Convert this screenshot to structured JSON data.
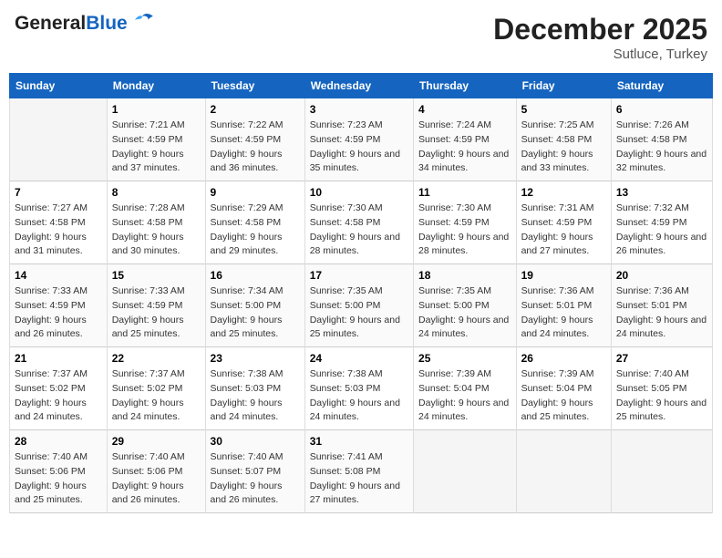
{
  "header": {
    "logo_general": "General",
    "logo_blue": "Blue",
    "month_title": "December 2025",
    "subtitle": "Sutluce, Turkey"
  },
  "days_of_week": [
    "Sunday",
    "Monday",
    "Tuesday",
    "Wednesday",
    "Thursday",
    "Friday",
    "Saturday"
  ],
  "weeks": [
    [
      {
        "day": "",
        "sunrise": "",
        "sunset": "",
        "daylight": ""
      },
      {
        "day": "1",
        "sunrise": "Sunrise: 7:21 AM",
        "sunset": "Sunset: 4:59 PM",
        "daylight": "Daylight: 9 hours and 37 minutes."
      },
      {
        "day": "2",
        "sunrise": "Sunrise: 7:22 AM",
        "sunset": "Sunset: 4:59 PM",
        "daylight": "Daylight: 9 hours and 36 minutes."
      },
      {
        "day": "3",
        "sunrise": "Sunrise: 7:23 AM",
        "sunset": "Sunset: 4:59 PM",
        "daylight": "Daylight: 9 hours and 35 minutes."
      },
      {
        "day": "4",
        "sunrise": "Sunrise: 7:24 AM",
        "sunset": "Sunset: 4:59 PM",
        "daylight": "Daylight: 9 hours and 34 minutes."
      },
      {
        "day": "5",
        "sunrise": "Sunrise: 7:25 AM",
        "sunset": "Sunset: 4:58 PM",
        "daylight": "Daylight: 9 hours and 33 minutes."
      },
      {
        "day": "6",
        "sunrise": "Sunrise: 7:26 AM",
        "sunset": "Sunset: 4:58 PM",
        "daylight": "Daylight: 9 hours and 32 minutes."
      }
    ],
    [
      {
        "day": "7",
        "sunrise": "Sunrise: 7:27 AM",
        "sunset": "Sunset: 4:58 PM",
        "daylight": "Daylight: 9 hours and 31 minutes."
      },
      {
        "day": "8",
        "sunrise": "Sunrise: 7:28 AM",
        "sunset": "Sunset: 4:58 PM",
        "daylight": "Daylight: 9 hours and 30 minutes."
      },
      {
        "day": "9",
        "sunrise": "Sunrise: 7:29 AM",
        "sunset": "Sunset: 4:58 PM",
        "daylight": "Daylight: 9 hours and 29 minutes."
      },
      {
        "day": "10",
        "sunrise": "Sunrise: 7:30 AM",
        "sunset": "Sunset: 4:58 PM",
        "daylight": "Daylight: 9 hours and 28 minutes."
      },
      {
        "day": "11",
        "sunrise": "Sunrise: 7:30 AM",
        "sunset": "Sunset: 4:59 PM",
        "daylight": "Daylight: 9 hours and 28 minutes."
      },
      {
        "day": "12",
        "sunrise": "Sunrise: 7:31 AM",
        "sunset": "Sunset: 4:59 PM",
        "daylight": "Daylight: 9 hours and 27 minutes."
      },
      {
        "day": "13",
        "sunrise": "Sunrise: 7:32 AM",
        "sunset": "Sunset: 4:59 PM",
        "daylight": "Daylight: 9 hours and 26 minutes."
      }
    ],
    [
      {
        "day": "14",
        "sunrise": "Sunrise: 7:33 AM",
        "sunset": "Sunset: 4:59 PM",
        "daylight": "Daylight: 9 hours and 26 minutes."
      },
      {
        "day": "15",
        "sunrise": "Sunrise: 7:33 AM",
        "sunset": "Sunset: 4:59 PM",
        "daylight": "Daylight: 9 hours and 25 minutes."
      },
      {
        "day": "16",
        "sunrise": "Sunrise: 7:34 AM",
        "sunset": "Sunset: 5:00 PM",
        "daylight": "Daylight: 9 hours and 25 minutes."
      },
      {
        "day": "17",
        "sunrise": "Sunrise: 7:35 AM",
        "sunset": "Sunset: 5:00 PM",
        "daylight": "Daylight: 9 hours and 25 minutes."
      },
      {
        "day": "18",
        "sunrise": "Sunrise: 7:35 AM",
        "sunset": "Sunset: 5:00 PM",
        "daylight": "Daylight: 9 hours and 24 minutes."
      },
      {
        "day": "19",
        "sunrise": "Sunrise: 7:36 AM",
        "sunset": "Sunset: 5:01 PM",
        "daylight": "Daylight: 9 hours and 24 minutes."
      },
      {
        "day": "20",
        "sunrise": "Sunrise: 7:36 AM",
        "sunset": "Sunset: 5:01 PM",
        "daylight": "Daylight: 9 hours and 24 minutes."
      }
    ],
    [
      {
        "day": "21",
        "sunrise": "Sunrise: 7:37 AM",
        "sunset": "Sunset: 5:02 PM",
        "daylight": "Daylight: 9 hours and 24 minutes."
      },
      {
        "day": "22",
        "sunrise": "Sunrise: 7:37 AM",
        "sunset": "Sunset: 5:02 PM",
        "daylight": "Daylight: 9 hours and 24 minutes."
      },
      {
        "day": "23",
        "sunrise": "Sunrise: 7:38 AM",
        "sunset": "Sunset: 5:03 PM",
        "daylight": "Daylight: 9 hours and 24 minutes."
      },
      {
        "day": "24",
        "sunrise": "Sunrise: 7:38 AM",
        "sunset": "Sunset: 5:03 PM",
        "daylight": "Daylight: 9 hours and 24 minutes."
      },
      {
        "day": "25",
        "sunrise": "Sunrise: 7:39 AM",
        "sunset": "Sunset: 5:04 PM",
        "daylight": "Daylight: 9 hours and 24 minutes."
      },
      {
        "day": "26",
        "sunrise": "Sunrise: 7:39 AM",
        "sunset": "Sunset: 5:04 PM",
        "daylight": "Daylight: 9 hours and 25 minutes."
      },
      {
        "day": "27",
        "sunrise": "Sunrise: 7:40 AM",
        "sunset": "Sunset: 5:05 PM",
        "daylight": "Daylight: 9 hours and 25 minutes."
      }
    ],
    [
      {
        "day": "28",
        "sunrise": "Sunrise: 7:40 AM",
        "sunset": "Sunset: 5:06 PM",
        "daylight": "Daylight: 9 hours and 25 minutes."
      },
      {
        "day": "29",
        "sunrise": "Sunrise: 7:40 AM",
        "sunset": "Sunset: 5:06 PM",
        "daylight": "Daylight: 9 hours and 26 minutes."
      },
      {
        "day": "30",
        "sunrise": "Sunrise: 7:40 AM",
        "sunset": "Sunset: 5:07 PM",
        "daylight": "Daylight: 9 hours and 26 minutes."
      },
      {
        "day": "31",
        "sunrise": "Sunrise: 7:41 AM",
        "sunset": "Sunset: 5:08 PM",
        "daylight": "Daylight: 9 hours and 27 minutes."
      },
      {
        "day": "",
        "sunrise": "",
        "sunset": "",
        "daylight": ""
      },
      {
        "day": "",
        "sunrise": "",
        "sunset": "",
        "daylight": ""
      },
      {
        "day": "",
        "sunrise": "",
        "sunset": "",
        "daylight": ""
      }
    ]
  ]
}
